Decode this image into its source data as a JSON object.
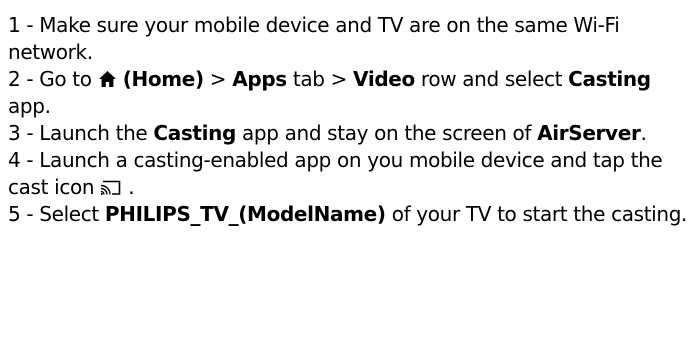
{
  "steps": [
    {
      "number": "1 - ",
      "text": "Make sure your mobile device and TV are on the same Wi-Fi network."
    },
    {
      "number": "2 - ",
      "pre_icon": "Go to ",
      "icon": "home-icon",
      "home_label": "(Home)",
      "sep1": " > ",
      "apps": "Apps",
      "apps_suffix": " tab > ",
      "video": "Video",
      "video_suffix": " row and select ",
      "casting": "Casting",
      "end": " app."
    },
    {
      "number": "3 - ",
      "pre": "Launch the ",
      "casting": "Casting",
      "mid": " app and stay on the screen of ",
      "airserver": "AirServer",
      "end": "."
    },
    {
      "number": "4 - ",
      "text": "Launch a casting-enabled app on you mobile device and tap the cast icon ",
      "icon": "cast-icon",
      "end": " ."
    },
    {
      "number": "5 - ",
      "pre": "Select ",
      "device_name": "PHILIPS_TV_(ModelName)",
      "end": " of your TV to start the casting."
    }
  ]
}
